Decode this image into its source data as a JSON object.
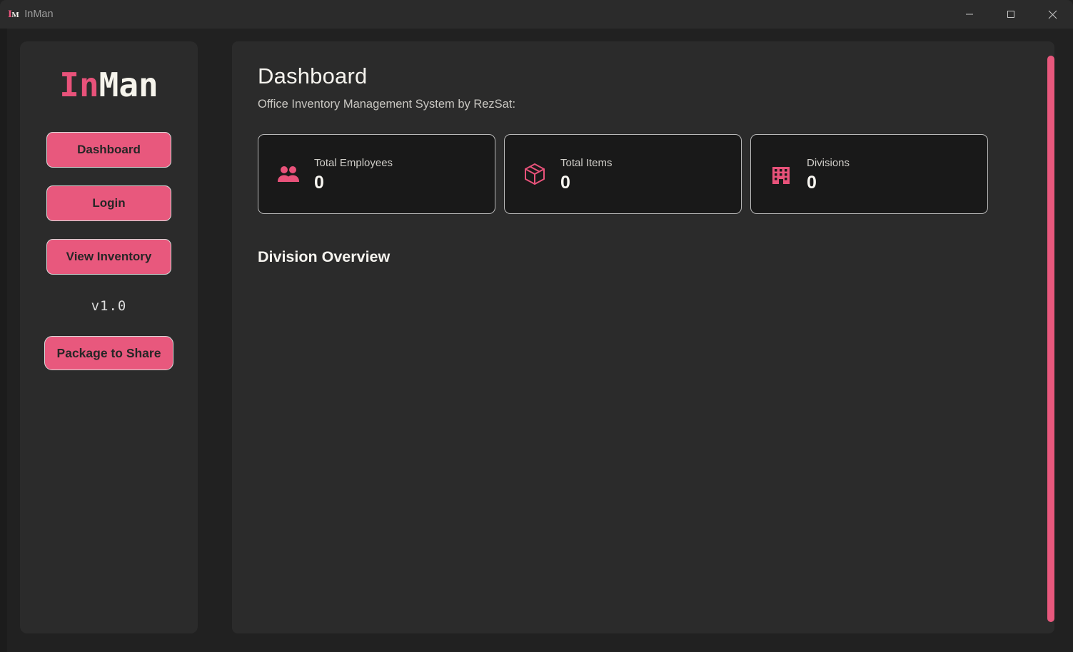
{
  "window": {
    "icon_primary": "I",
    "icon_secondary": "M",
    "title": "InMan",
    "controls": {
      "minimize": "minimize-icon",
      "maximize": "maximize-icon",
      "close": "close-icon"
    }
  },
  "sidebar": {
    "logo_part1": "In",
    "logo_part2": "Man",
    "nav_items": [
      {
        "label": "Dashboard"
      },
      {
        "label": "Login"
      },
      {
        "label": "View Inventory"
      }
    ],
    "version": "v1.0",
    "package_button": "Package to Share"
  },
  "main": {
    "title": "Dashboard",
    "subtitle": "Office Inventory Management System by RezSat:",
    "stats": [
      {
        "icon": "users-icon",
        "label": "Total Employees",
        "value": "0"
      },
      {
        "icon": "package-icon",
        "label": "Total Items",
        "value": "0"
      },
      {
        "icon": "building-icon",
        "label": "Divisions",
        "value": "0"
      }
    ],
    "section_title": "Division Overview"
  },
  "colors": {
    "accent": "#e8587d",
    "accent_text": "#e8527a",
    "panel": "#2b2b2b",
    "background": "#212121",
    "card": "#191919",
    "card_border": "#b9b9b9",
    "text_primary": "#f6f4ef",
    "text_secondary": "#c9c7c2"
  }
}
